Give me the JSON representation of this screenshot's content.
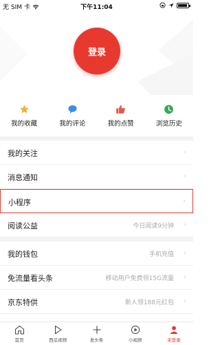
{
  "status_bar": {
    "carrier": "无 SIM 卡",
    "time": "下午11:04"
  },
  "login": {
    "label": "登录"
  },
  "quick_actions": [
    {
      "label": "我的收藏",
      "icon": "star-icon",
      "color": "#f0b03a"
    },
    {
      "label": "我的评论",
      "icon": "comment-icon",
      "color": "#3a8de8"
    },
    {
      "label": "我的点赞",
      "icon": "thumbs-up-icon",
      "color": "#e8564a"
    },
    {
      "label": "浏览历史",
      "icon": "clock-icon",
      "color": "#3aa65a"
    }
  ],
  "menu": {
    "group1": [
      {
        "label": "我的关注",
        "value": ""
      },
      {
        "label": "消息通知",
        "value": ""
      },
      {
        "label": "小程序",
        "value": ""
      },
      {
        "label": "阅读公益",
        "value": "今日阅读9分钟"
      }
    ],
    "group2": [
      {
        "label": "我的钱包",
        "value": "手机充值"
      },
      {
        "label": "免流量看头条",
        "value": "移动用户免费领15G流量"
      },
      {
        "label": "京东特供",
        "value": "新人领188元红包"
      }
    ]
  },
  "tabbar": [
    {
      "label": "首页",
      "icon": "home-icon"
    },
    {
      "label": "西瓜视频",
      "icon": "play-icon"
    },
    {
      "label": "发头条",
      "icon": "plus-icon"
    },
    {
      "label": "小视频",
      "icon": "small-video-icon"
    },
    {
      "label": "未登录",
      "icon": "profile-icon",
      "active": true
    }
  ],
  "colors": {
    "accent": "#e8392f"
  }
}
